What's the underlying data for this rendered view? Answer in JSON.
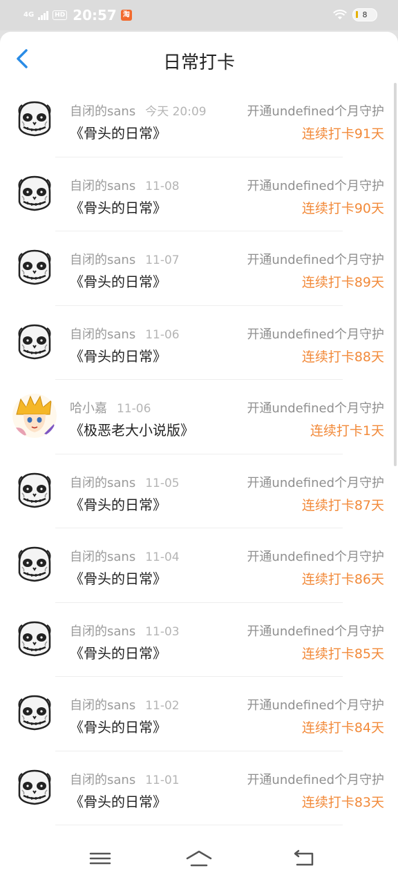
{
  "status_bar": {
    "signal": "4G",
    "hd": "HD",
    "time": "20:57",
    "app_badge": "8",
    "battery": "8"
  },
  "header": {
    "title": "日常打卡"
  },
  "items": [
    {
      "name": "自闭的sans",
      "date": "今天  20:09",
      "book": "《骨头的日常》",
      "guard": "开通undefined个月守护",
      "streak": "连续打卡91天",
      "avatar": "skull-avatar"
    },
    {
      "name": "自闭的sans",
      "date": "11-08",
      "book": "《骨头的日常》",
      "guard": "开通undefined个月守护",
      "streak": "连续打卡90天",
      "avatar": "skull-avatar"
    },
    {
      "name": "自闭的sans",
      "date": "11-07",
      "book": "《骨头的日常》",
      "guard": "开通undefined个月守护",
      "streak": "连续打卡89天",
      "avatar": "skull-avatar"
    },
    {
      "name": "自闭的sans",
      "date": "11-06",
      "book": "《骨头的日常》",
      "guard": "开通undefined个月守护",
      "streak": "连续打卡88天",
      "avatar": "skull-avatar"
    },
    {
      "name": "哈小嘉",
      "date": "11-06",
      "book": "《极恶老大小说版》",
      "guard": "开通undefined个月守护",
      "streak": "连续打卡1天",
      "avatar": "anime-avatar"
    },
    {
      "name": "自闭的sans",
      "date": "11-05",
      "book": "《骨头的日常》",
      "guard": "开通undefined个月守护",
      "streak": "连续打卡87天",
      "avatar": "skull-avatar"
    },
    {
      "name": "自闭的sans",
      "date": "11-04",
      "book": "《骨头的日常》",
      "guard": "开通undefined个月守护",
      "streak": "连续打卡86天",
      "avatar": "skull-avatar"
    },
    {
      "name": "自闭的sans",
      "date": "11-03",
      "book": "《骨头的日常》",
      "guard": "开通undefined个月守护",
      "streak": "连续打卡85天",
      "avatar": "skull-avatar"
    },
    {
      "name": "自闭的sans",
      "date": "11-02",
      "book": "《骨头的日常》",
      "guard": "开通undefined个月守护",
      "streak": "连续打卡84天",
      "avatar": "skull-avatar"
    },
    {
      "name": "自闭的sans",
      "date": "11-01",
      "book": "《骨头的日常》",
      "guard": "开通undefined个月守护",
      "streak": "连续打卡83天",
      "avatar": "skull-avatar"
    }
  ],
  "icons": {
    "back": "back-arrow-icon",
    "menu": "menu-icon",
    "home": "home-icon",
    "return": "return-icon"
  },
  "colors": {
    "accent": "#2a8ce6",
    "streak": "#f28a3a"
  }
}
